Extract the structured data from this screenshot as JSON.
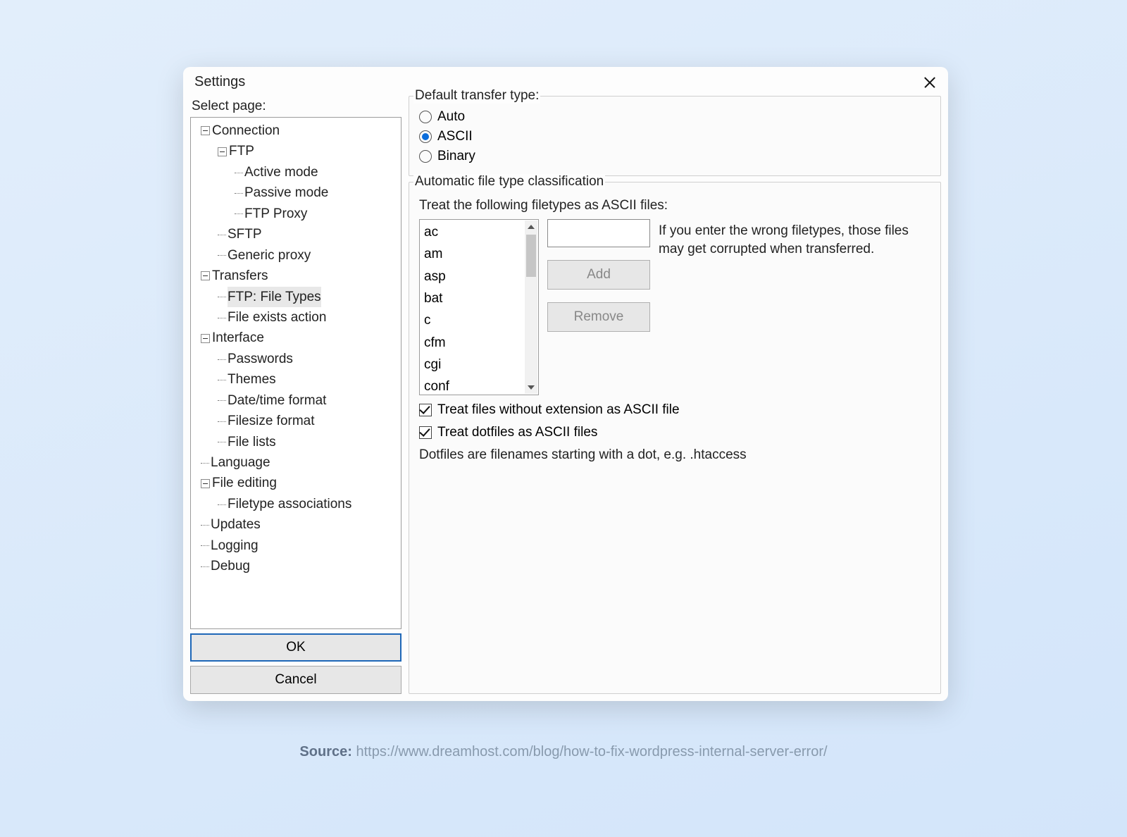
{
  "window": {
    "title": "Settings"
  },
  "left": {
    "select_page": "Select page:",
    "ok": "OK",
    "cancel": "Cancel",
    "tree": {
      "connection": "Connection",
      "ftp": "FTP",
      "active": "Active mode",
      "passive": "Passive mode",
      "ftp_proxy": "FTP Proxy",
      "sftp": "SFTP",
      "generic_proxy": "Generic proxy",
      "transfers": "Transfers",
      "ftp_file_types": "FTP: File Types",
      "file_exists": "File exists action",
      "interface": "Interface",
      "passwords": "Passwords",
      "themes": "Themes",
      "datetime": "Date/time format",
      "filesize": "Filesize format",
      "file_lists": "File lists",
      "language": "Language",
      "file_editing": "File editing",
      "filetype_assoc": "Filetype associations",
      "updates": "Updates",
      "logging": "Logging",
      "debug": "Debug"
    }
  },
  "transfer_type": {
    "legend": "Default transfer type:",
    "auto": "Auto",
    "ascii": "ASCII",
    "binary": "Binary",
    "selected": "ASCII"
  },
  "auto_class": {
    "legend": "Automatic file type classification",
    "treat_following": "Treat the following filetypes as ASCII files:",
    "filetypes": [
      "ac",
      "am",
      "asp",
      "bat",
      "c",
      "cfm",
      "cgi",
      "conf"
    ],
    "add": "Add",
    "remove": "Remove",
    "warning": "If you enter the wrong filetypes, those files may get corrupted when transferred.",
    "chk_no_ext": "Treat files without extension as ASCII file",
    "chk_dotfiles": "Treat dotfiles as ASCII files",
    "dotfiles_hint": "Dotfiles are filenames starting with a dot, e.g. .htaccess"
  },
  "source": {
    "label": "Source:",
    "url": "https://www.dreamhost.com/blog/how-to-fix-wordpress-internal-server-error/"
  }
}
